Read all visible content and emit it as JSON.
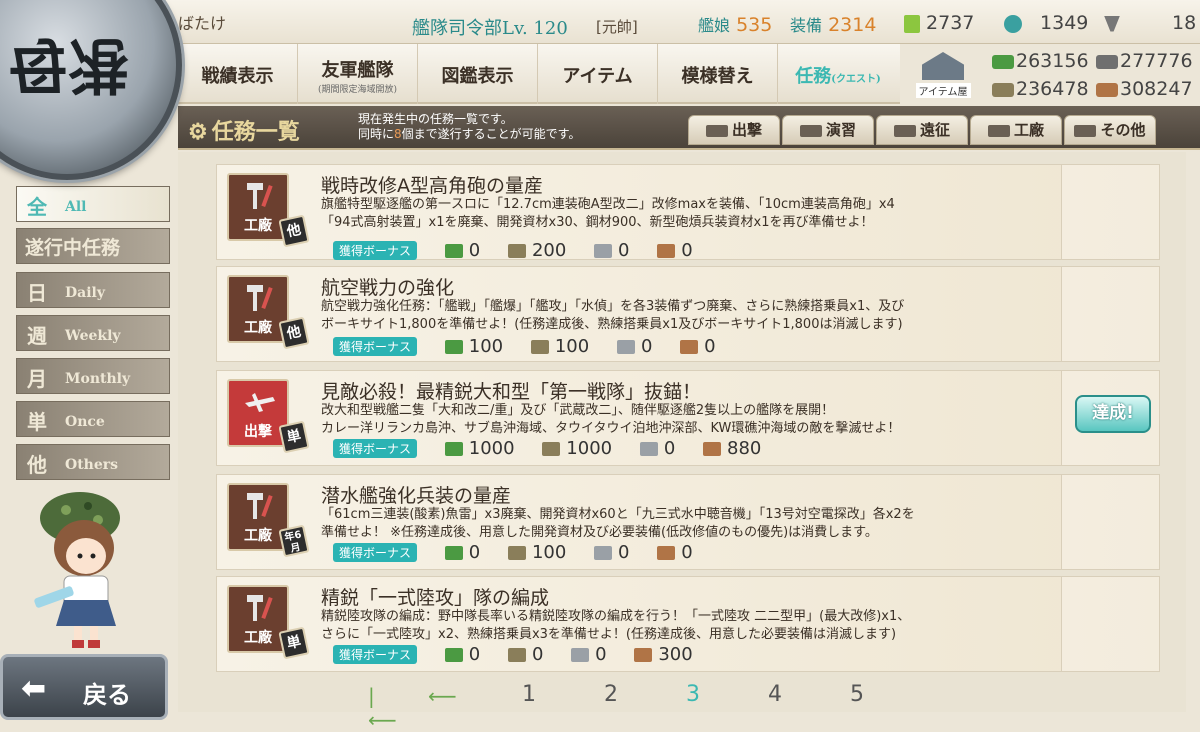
{
  "header_bar": {
    "admiral": "ばたけ",
    "hq_label": "艦隊司令部",
    "hq_level": "Lv. 120",
    "rank": "[元帥]",
    "ships_label": "艦娘",
    "ships_value": "535",
    "equip_label": "装備",
    "equip_value": "2314",
    "bucket": "2737",
    "devmat": "1349",
    "screw": "18"
  },
  "emblem": "母港",
  "menu": {
    "items": [
      {
        "label": "戦績表示",
        "sub": ""
      },
      {
        "label": "友軍艦隊",
        "sub": "(期間限定海域開放)"
      },
      {
        "label": "図鑑表示",
        "sub": ""
      },
      {
        "label": "アイテム",
        "sub": ""
      },
      {
        "label": "模様替え",
        "sub": ""
      },
      {
        "label": "任務",
        "sub": "(クエスト)"
      }
    ],
    "shop_label": "アイテム屋"
  },
  "resources": {
    "fuel": "263156",
    "ammo": "277776",
    "steel": "236478",
    "bauxite": "308247"
  },
  "quest_header": {
    "title": "任務一覧",
    "desc_line1": "現在発生中の任務一覧です。",
    "desc_line2a": "同時に",
    "desc_line2n": "8",
    "desc_line2b": "個まで遂行することが可能です。",
    "filters": [
      "出撃",
      "演習",
      "遠征",
      "工廠",
      "その他"
    ]
  },
  "sidebar": {
    "items": [
      {
        "kanji": "全",
        "label": "All"
      },
      {
        "kanji": "遂行中任務",
        "label": ""
      },
      {
        "kanji": "日",
        "label": "Daily"
      },
      {
        "kanji": "週",
        "label": "Weekly"
      },
      {
        "kanji": "月",
        "label": "Monthly"
      },
      {
        "kanji": "単",
        "label": "Once"
      },
      {
        "kanji": "他",
        "label": "Others"
      }
    ]
  },
  "bonus_label": "獲得ボーナス",
  "quests": [
    {
      "icon": "工廠",
      "tag": "他",
      "title": "戦時改修A型高角砲の量産",
      "line1": "旗艦特型駆逐艦の第一スロに「12.7cm連装砲A型改二」改修maxを装備、「10cm連装高角砲」x4",
      "line2": "「94式高射装置」x1を廃棄、開発資材x30、鋼材900、新型砲熕兵装資材x1を再び準備せよ！",
      "fuel": "0",
      "ammo": "200",
      "steel": "0",
      "baux": "0",
      "status": ""
    },
    {
      "icon": "工廠",
      "tag": "他",
      "title": "航空戦力の強化",
      "line1": "航空戦力強化任務：「艦戦」「艦爆」「艦攻」「水偵」を各3装備ずつ廃棄、さらに熟練搭乗員x1、及び",
      "line2": "ボーキサイト1,800を準備せよ！(任務達成後、熟練搭乗員x1及びボーキサイト1,800は消滅します)",
      "fuel": "100",
      "ammo": "100",
      "steel": "0",
      "baux": "0",
      "status": ""
    },
    {
      "icon": "出撃",
      "tag": "単",
      "title": "見敵必殺！最精鋭大和型「第一戦隊」抜錨！",
      "line1": "改大和型戦艦二隻「大和改二/重」及び「武蔵改二」、随伴駆逐艦2隻以上の艦隊を展開！",
      "line2": "カレー洋リランカ島沖、サブ島沖海域、タウイタウイ泊地沖深部、KW環礁沖海域の敵を撃滅せよ！",
      "fuel": "1000",
      "ammo": "1000",
      "steel": "0",
      "baux": "880",
      "status": "達成!"
    },
    {
      "icon": "工廠",
      "tag": "年6月",
      "title": "潜水艦強化兵装の量産",
      "line1": "「61cm三連装(酸素)魚雷」x3廃棄、開発資材x60と「九三式水中聴音機」「13号対空電探改」各x2を",
      "line2": "準備せよ！ ※任務達成後、用意した開発資材及び必要装備(低改修値のもの優先)は消費します。",
      "fuel": "0",
      "ammo": "100",
      "steel": "0",
      "baux": "0",
      "status": ""
    },
    {
      "icon": "工廠",
      "tag": "単",
      "title": "精鋭「一式陸攻」隊の編成",
      "line1": "精鋭陸攻隊の編成：野中隊長率いる精鋭陸攻隊の編成を行う！「一式陸攻 二二型甲」(最大改修)x1、",
      "line2": "さらに「一式陸攻」x2、熟練搭乗員x3を準備せよ！(任務達成後、用意した必要装備は消滅します)",
      "fuel": "0",
      "ammo": "0",
      "steel": "0",
      "baux": "300",
      "status": ""
    }
  ],
  "pager": {
    "pages": [
      "1",
      "2",
      "3",
      "4",
      "5"
    ],
    "current": "3"
  },
  "back_label": "戻る"
}
